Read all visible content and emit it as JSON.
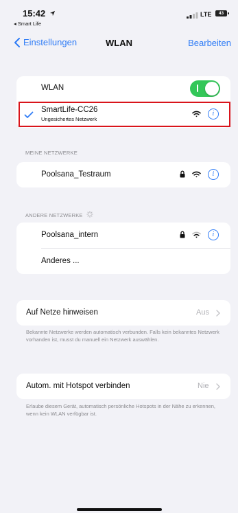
{
  "status_bar": {
    "time": "15:42",
    "back_app": "◂ Smart Life",
    "network": "LTE",
    "battery": "43"
  },
  "nav": {
    "back_label": "Einstellungen",
    "title": "WLAN",
    "edit_label": "Bearbeiten"
  },
  "wlan": {
    "label": "WLAN",
    "toggle_on": true,
    "connected_name": "SmartLife-CC26",
    "connected_subtitle": "Ungesichertes Netzwerk"
  },
  "my_networks": {
    "header": "MEINE NETZWERKE",
    "items": [
      {
        "name": "Poolsana_Testraum",
        "secured": true
      }
    ]
  },
  "other_networks": {
    "header": "ANDERE NETZWERKE",
    "items": [
      {
        "name": "Poolsana_intern",
        "secured": true
      },
      {
        "name": "Anderes ..."
      }
    ]
  },
  "ask_to_join": {
    "label": "Auf Netze hinweisen",
    "value": "Aus",
    "footer": "Bekannte Netzwerke werden automatisch verbunden. Falls kein bekanntes Netzwerk vorhanden ist, musst du manuell ein Netzwerk auswählen."
  },
  "hotspot": {
    "label": "Autom. mit Hotspot verbinden",
    "value": "Nie",
    "footer": "Erlaube diesem Gerät, automatisch persönliche Hotspots in der Nähe zu erkennen, wenn kein WLAN verfügbar ist."
  },
  "colors": {
    "accent": "#2f7cf6",
    "toggle_on": "#34c759",
    "highlight": "#d9141b",
    "background": "#f2f2f7"
  }
}
